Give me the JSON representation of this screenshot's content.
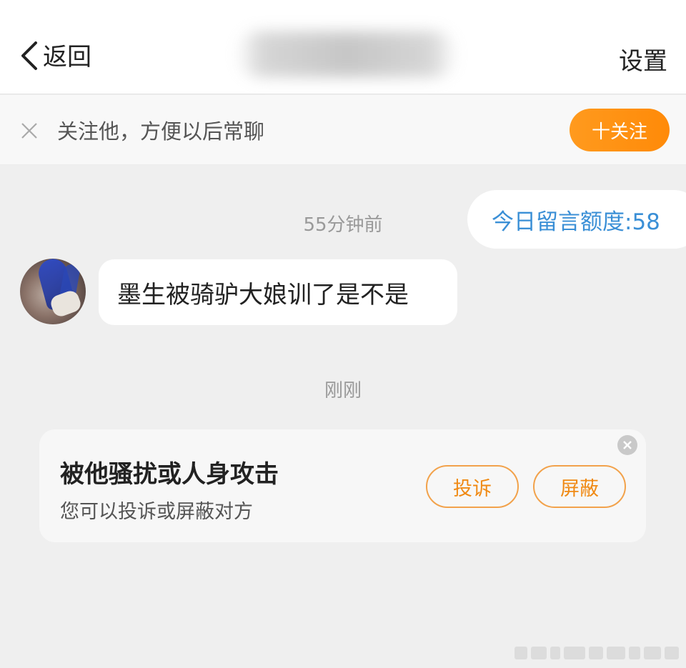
{
  "header": {
    "back_label": "返回",
    "settings_label": "设置"
  },
  "follow_bar": {
    "text": "关注他，方便以后常聊",
    "button_label": "十关注"
  },
  "chat": {
    "quota_text": "今日留言额度:58",
    "timestamps": [
      "55分钟前",
      "刚刚"
    ],
    "message": "墨生被骑驴大娘训了是不是"
  },
  "report_card": {
    "title": "被他骚扰或人身攻击",
    "subtitle": "您可以投诉或屏蔽对方",
    "complain_label": "投诉",
    "block_label": "屏蔽"
  },
  "colors": {
    "accent_orange": "#ff9a1e",
    "quota_blue": "#3a8fd6",
    "background": "#efefef"
  }
}
